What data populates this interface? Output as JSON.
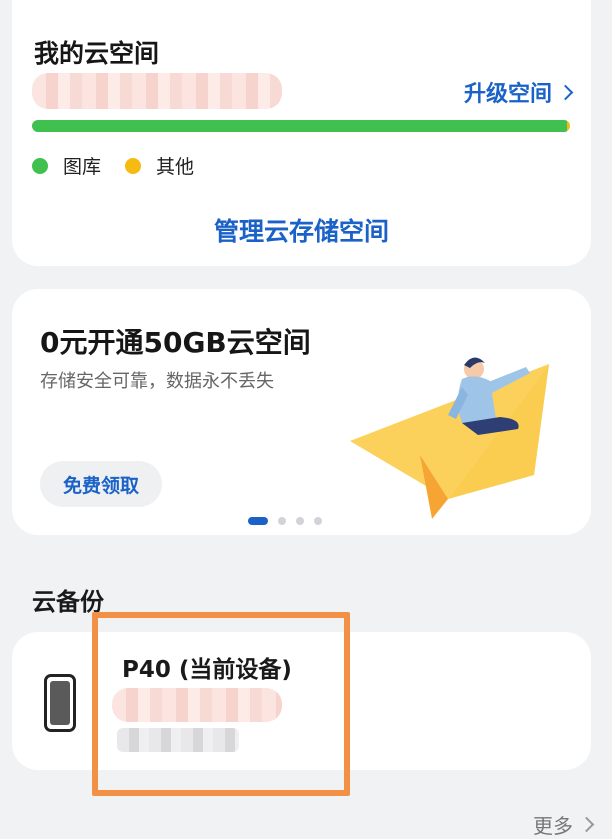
{
  "storage": {
    "title": "我的云空间",
    "upgrade_label": "升级空间",
    "usage_gallery_fraction": 0.995,
    "usage_other_fraction": 0.005,
    "legend": [
      {
        "label": "图库",
        "color": "#3fc04f"
      },
      {
        "label": "其他",
        "color": "#f5bb13"
      }
    ],
    "manage_label": "管理云存储空间"
  },
  "promo": {
    "title": "0元开通50GB云空间",
    "subtitle": "存储安全可靠，数据永不丢失",
    "button_label": "免费领取",
    "carousel_pages": 4,
    "carousel_active": 1
  },
  "backup": {
    "section_title": "云备份",
    "device_name": "P40 (当前设备)"
  },
  "next_section": {
    "more_label": "更多"
  },
  "colors": {
    "accent": "#1b62c8",
    "highlight": "#f29045"
  },
  "icons": {
    "phone": "phone-icon",
    "chevron": "chevron-right-icon"
  }
}
